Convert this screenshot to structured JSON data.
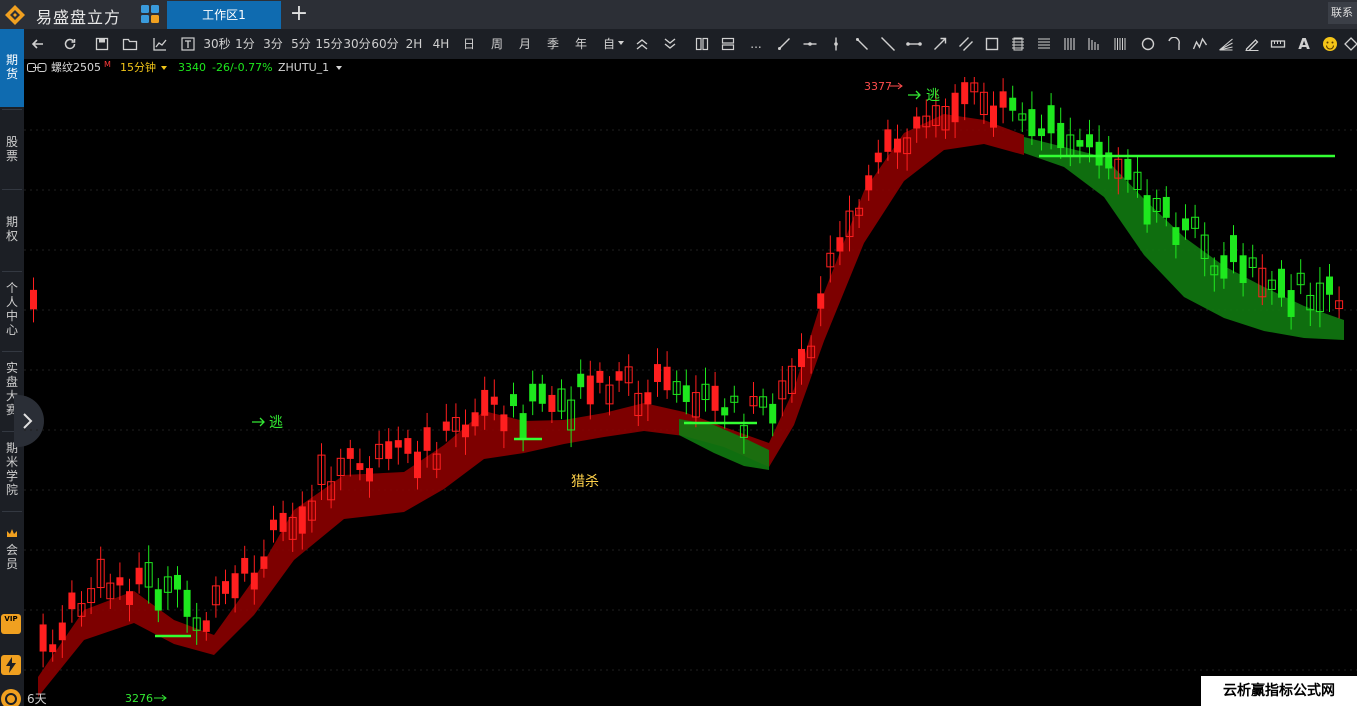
{
  "app": {
    "title": "易盛盘立方",
    "active_tab": "工作区1",
    "add_tab_symbol": "+",
    "contact_label": "联系"
  },
  "sidebar": {
    "items": [
      {
        "label": "期货",
        "active": true
      },
      {
        "label": "股票",
        "active": false
      },
      {
        "label": "期权",
        "active": false
      },
      {
        "label": "个人中心",
        "active": false
      },
      {
        "label": "实盘大赛",
        "active": false
      },
      {
        "label": "期米学院",
        "active": false
      },
      {
        "label": "会员",
        "active": false
      }
    ],
    "vip_badge": "VIP"
  },
  "toolbar": {
    "periods": [
      "30秒",
      "1分",
      "3分",
      "5分",
      "15分",
      "30分",
      "60分",
      "2H",
      "4H",
      "日",
      "周",
      "月",
      "季",
      "年",
      "自"
    ],
    "more_label": "...",
    "text_tool": "A"
  },
  "info": {
    "symbol": "螺纹2505",
    "symbol_mark": "M",
    "period": "15分钟",
    "price": "3340",
    "change": "-26/-0.77%",
    "indicator": "ZHUTU_1"
  },
  "chart_data": {
    "type": "candlestick",
    "annotations": {
      "escape_label": "逃",
      "hunt_label": "猎杀",
      "high_price": "3377",
      "low_price": "3276",
      "days_label": "6天"
    },
    "colors": {
      "up": "#ff1f1f",
      "down": "#1ee81e",
      "band_up": "#8b0000",
      "band_down": "#117a11",
      "signal_line": "#33ff33",
      "label_yellow": "#ffd24a",
      "label_red": "#ff4d4d",
      "label_green": "#33e833"
    }
  },
  "watermark": "云析赢指标公式网"
}
